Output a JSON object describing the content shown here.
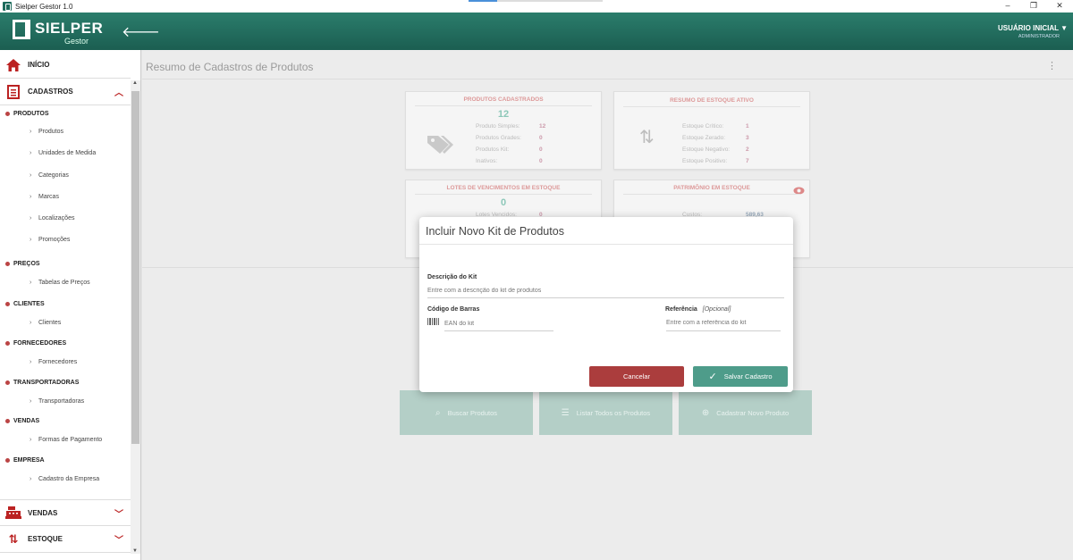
{
  "window": {
    "title": "Sielper Gestor 1.0",
    "minimize": "–",
    "restore": "❐",
    "close": "✕"
  },
  "header": {
    "brand": "SIELPER",
    "brand_sub": "Gestor",
    "back_icon": "arrow-left-icon",
    "user_name": "USUÁRIO INICIAL",
    "user_role": "ADMINISTRADOR",
    "accent": "#1f6b5c"
  },
  "sidebar": {
    "inicio": "INÍCIO",
    "cadastros": "CADASTROS",
    "groups": {
      "produtos": "PRODUTOS",
      "precos": "PREÇOS",
      "clientes": "CLIENTES",
      "fornecedores": "FORNECEDORES",
      "transportadoras": "TRANSPORTADORAS",
      "vendas": "VENDAS",
      "empresa": "EMPRESA"
    },
    "items": {
      "produtos": "Produtos",
      "unidades": "Unidades de Medida",
      "categorias": "Categorias",
      "marcas": "Marcas",
      "localizacoes": "Localizações",
      "promocoes": "Promoções",
      "tabelas_precos": "Tabelas de Preços",
      "clientes": "Clientes",
      "fornecedores": "Fornecedores",
      "transportadoras": "Transportadoras",
      "formas_pagamento": "Formas de Pagamento",
      "cadastro_empresa": "Cadastro da Empresa"
    },
    "vendas_main": "VENDAS",
    "estoque_main": "ESTOQUE"
  },
  "main": {
    "title": "Resumo de Cadastros de Produtos",
    "produtos_card": {
      "title": "PRODUTOS CADASTRADOS",
      "total": "12",
      "rows": [
        {
          "label": "Produto Simples:",
          "value": "12"
        },
        {
          "label": "Produtos Grades:",
          "value": "0"
        },
        {
          "label": "Produtos Kit:",
          "value": "0"
        },
        {
          "label": "Inativos:",
          "value": "0"
        }
      ]
    },
    "estoque_card": {
      "title": "RESUMO DE ESTOQUE ATIVO",
      "rows": [
        {
          "label": "Estoque Crítico:",
          "value": "1"
        },
        {
          "label": "Estoque Zerado:",
          "value": "3"
        },
        {
          "label": "Estoque Negativo:",
          "value": "2"
        },
        {
          "label": "Estoque Positivo:",
          "value": "7"
        }
      ]
    },
    "lotes_card": {
      "title": "LOTES DE VENCIMENTOS EM ESTOQUE",
      "total": "0",
      "row": {
        "label": "Lotes Vencidos:",
        "value": "0"
      }
    },
    "patrimonio_card": {
      "title": "PATRIMÔNIO EM ESTOQUE",
      "row": {
        "label": "Custos:",
        "value": "589,63"
      }
    },
    "actions": {
      "buscar": "Buscar Produtos",
      "listar": "Listar Todos os Produtos",
      "cadastrar": "Cadastrar Novo Produto"
    }
  },
  "modal": {
    "title": "Incluir Novo Kit de Produtos",
    "descricao_label": "Descrição do Kit",
    "descricao_placeholder": "Entre com a descrição do kit de produtos",
    "barras_label": "Código de Barras",
    "barras_placeholder": "EAN do kit",
    "referencia_label": "Referência",
    "referencia_optional": "[Opcional]",
    "referencia_placeholder": "Entre com a referência do kit",
    "cancel": "Cancelar",
    "save": "Salvar Cadastro",
    "cancel_color": "#ab3d3d",
    "save_color": "#4e9c8a"
  }
}
